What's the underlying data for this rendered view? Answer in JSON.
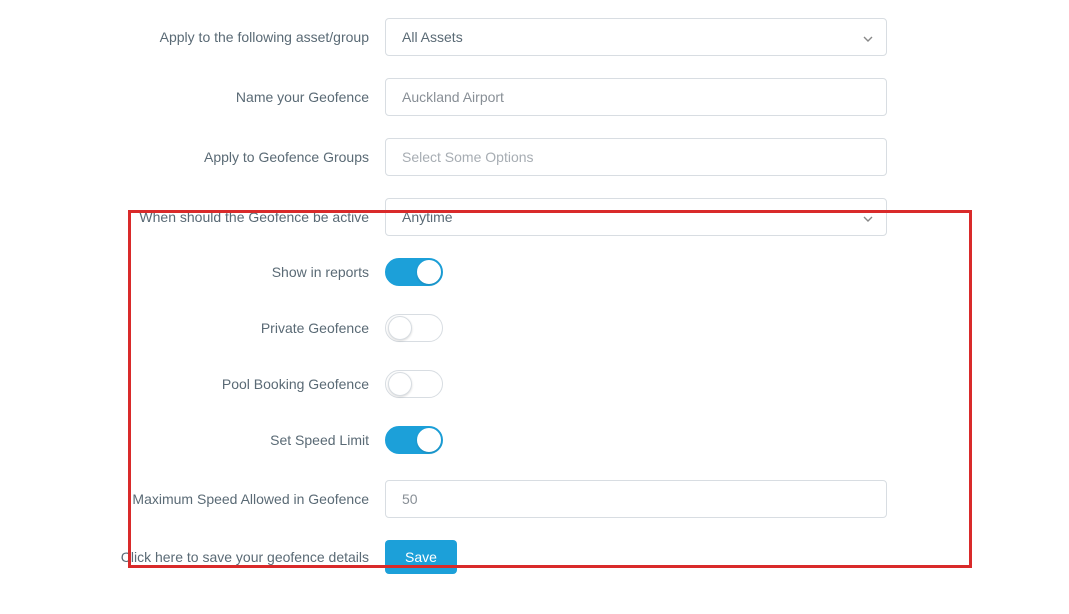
{
  "labels": {
    "asset_group": "Apply to the following asset/group",
    "name_geofence": "Name your Geofence",
    "geofence_groups": "Apply to Geofence Groups",
    "when_active": "When should the Geofence be active",
    "show_reports": "Show in reports",
    "private_geofence": "Private Geofence",
    "pool_booking": "Pool Booking Geofence",
    "set_speed_limit": "Set Speed Limit",
    "max_speed": "Maximum Speed Allowed in Geofence",
    "save_hint": "Click here to save your geofence details"
  },
  "values": {
    "asset_group_selected": "All Assets",
    "geofence_name": "Auckland Airport",
    "geofence_groups_placeholder": "Select Some Options",
    "when_active_selected": "Anytime",
    "max_speed_value": "50"
  },
  "toggles": {
    "show_reports": true,
    "private_geofence": false,
    "pool_booking": false,
    "set_speed_limit": true
  },
  "buttons": {
    "save": "Save"
  }
}
